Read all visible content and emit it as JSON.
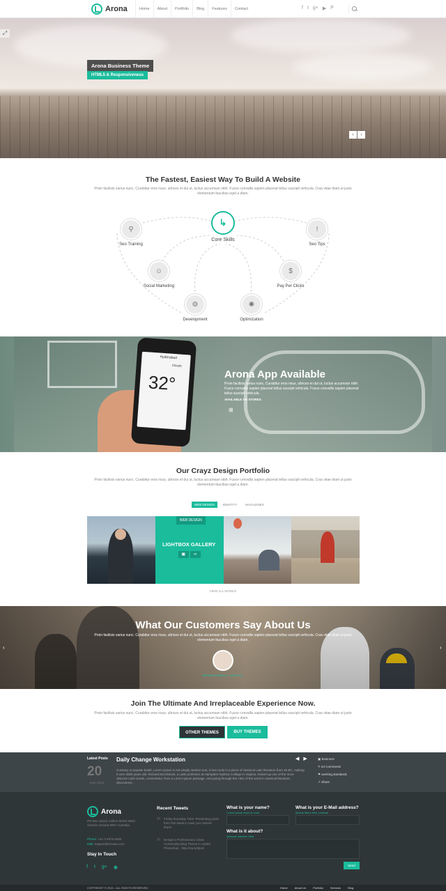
{
  "header": {
    "logo_text": "Arona",
    "nav": [
      "Home",
      "About",
      "Portfolio",
      "Blog",
      "Features",
      "Contact"
    ],
    "social_icons": [
      "facebook-icon",
      "twitter-icon",
      "google-plus-icon",
      "youtube-icon",
      "pinterest-icon"
    ]
  },
  "hero": {
    "title": "Arona Business Theme",
    "subtitle": "HTML5 & Responsiveness",
    "prev": "‹",
    "next": "›"
  },
  "skills_section": {
    "title": "The Fastest, Easiest Way To Build A Website",
    "text": "Proin facilisis varius nunc. Curabitur eros risus, ultrices et dui ut, luctus accumsan nibh. Fusce convallis sapien placerat tellus suscipit vehicula. Cras vitae diam ut justo elementum faucibus eget a diam.",
    "core": "Core Skills",
    "items": [
      "Seo Training",
      "Seo Tips",
      "Social Marketing",
      "Pay Per Clicks",
      "Development",
      "Optimization"
    ]
  },
  "app_band": {
    "title": "Arona App Available",
    "text": "Proin facilisis varius nunc. Curabitur eros risus, ultrices et dui ut, luctus accumsan nibh. Fusce convallis sapien placerat tellus suscipit vehicula. Fusce convallis sapien placerat tellus suscipit vehicula.",
    "available": "AVAILABLE ON STORES",
    "phone_city": "Hyderabad",
    "phone_weather": "Clouds",
    "phone_temp": "32°"
  },
  "portfolio": {
    "title": "Our Crayz Design Portfolio",
    "text": "Proin facilisis varius nunc. Curabitur eros risus, ultrices et dui ut, luctus accumsan nibh. Fusce convallis sapien placerat tellus suscipit vehicula. Cras vitae diam ut justo elementum faucibus eget a diam.",
    "filters": [
      "WEB DESIGN",
      "IDENTITY",
      "MAGAZINES"
    ],
    "tile_tag": "WEB DESIGN",
    "tile_title": "LIGHTBOX GALLERY",
    "view_all": "VIEW ALL WORKS"
  },
  "testimonials": {
    "title": "What Our Customers Say About Us",
    "text": "Proin facilisis varius nunc. Curabitur eros risus, ultrices et dui ut, luctus accumsan nibh. Fusce convallis sapien placerat tellus suscipit vehicula. Cras vitae diam ut justo elementum faucibus eget a diam.",
    "name": "Michael Anderson, ARAS Inc.",
    "prev": "‹",
    "next": "›"
  },
  "cta": {
    "title": "Join The Ultimate And Irreplaceable Experience Now.",
    "text": "Proin facilisis varius nunc. Curabitur eros risus, ultrices et dui ut, luctus accumsan nibh. Fusce convallis sapien placerat tellus suscipit vehicula. Cras vitae diam ut justo elementum faucibus eget a diam.",
    "other": "OTHER THEMES",
    "buy": "BUY THEMES"
  },
  "latest_posts": {
    "label": "Latest Posts",
    "day": "20",
    "month": "June 2013",
    "post_title": "Daily Change Workstation",
    "post_text": "Contrary to popular belief, Lorem Ipsum is not simply random text. It has roots in a piece of classical Latin literature from 45 BC, making it over 2000 years old. Richard McClintock, a Latin professor at Hampden-Sydney College in Virginia, looked up one of the more obscure Latin words, consectetur, from a Lorem Ipsum passage, and going through the cites of the word in classical literature, discovered...",
    "meta": [
      "Business",
      "64 Comments",
      "working,standards",
      "Share"
    ]
  },
  "footer": {
    "logo_text": "Arona",
    "address": "PO Box 16122 Collins Street West Victoria Victoria 8007 Australia",
    "phone_label": "Phone:",
    "phone": "+61 3 8376 6284",
    "mail_label": "Mail:",
    "mail": "support@envato.com",
    "stay": "Stay In Touch",
    "social_icons": [
      "facebook-icon",
      "twitter-icon",
      "google-plus-icon",
      "rss-icon"
    ],
    "tweets_title": "Recent Tweets",
    "tweets": [
      "Friday Roundup Time: Presenting posts from this week in case you missed them!",
      "Design a Professional, Clean Community Blog Theme in Adobe Photoshop - http://ow.ly/3jUvi"
    ],
    "q_name": "What is your name?",
    "q_name_hint": "Lorem ipsum dolor eu cras",
    "q_email": "What is your E-Mail address?",
    "q_email_hint": "Mauris libero felis, pulvinar",
    "q_about": "What is it about?",
    "q_about_hint": "Quisque dapibus vitae",
    "send": "Send"
  },
  "bottom": {
    "copyright": "COPYRIGHT © 2013 - ALL RIGHTS RESERVED",
    "nav": [
      "Home",
      "About Us",
      "Portfolio",
      "Services",
      "Blog"
    ]
  },
  "colors": {
    "accent": "#1abc9c",
    "dark": "#2f3638"
  }
}
